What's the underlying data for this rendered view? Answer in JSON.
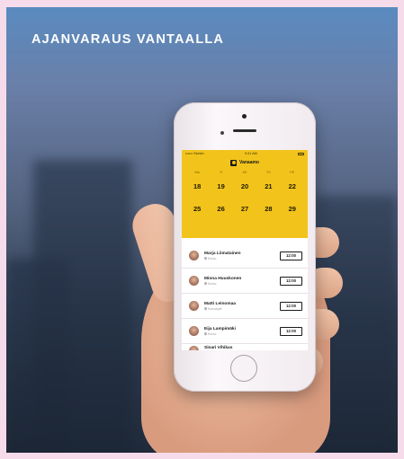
{
  "headline": "AJANVARAUS VANTAALLA",
  "status": {
    "carrier": "•••••• Sketch",
    "time": "9:41 AM"
  },
  "app": {
    "name": "Vanaamo",
    "logo_icon": "vantaa-logo-icon"
  },
  "calendar": {
    "days": [
      "MA",
      "TI",
      "KE",
      "TO",
      "PE"
    ],
    "week1": [
      "18",
      "19",
      "20",
      "21",
      "22"
    ],
    "week2": [
      "25",
      "26",
      "27",
      "28",
      "29"
    ]
  },
  "people": [
    {
      "name": "Marja Liimatainen",
      "place": "Korso",
      "time": "12:00"
    },
    {
      "name": "Minna Huuskonen",
      "place": "Korso",
      "time": "12:00"
    },
    {
      "name": "Matti Leinomaa",
      "place": "Koivukylä",
      "time": "12:00"
    },
    {
      "name": "Eija Lampimäki",
      "place": "Korso",
      "time": "12:00"
    },
    {
      "name": "Sinari Vihikas",
      "place": "",
      "time": ""
    }
  ],
  "colors": {
    "accent": "#f2c41b",
    "page_border": "#f6dcea"
  }
}
